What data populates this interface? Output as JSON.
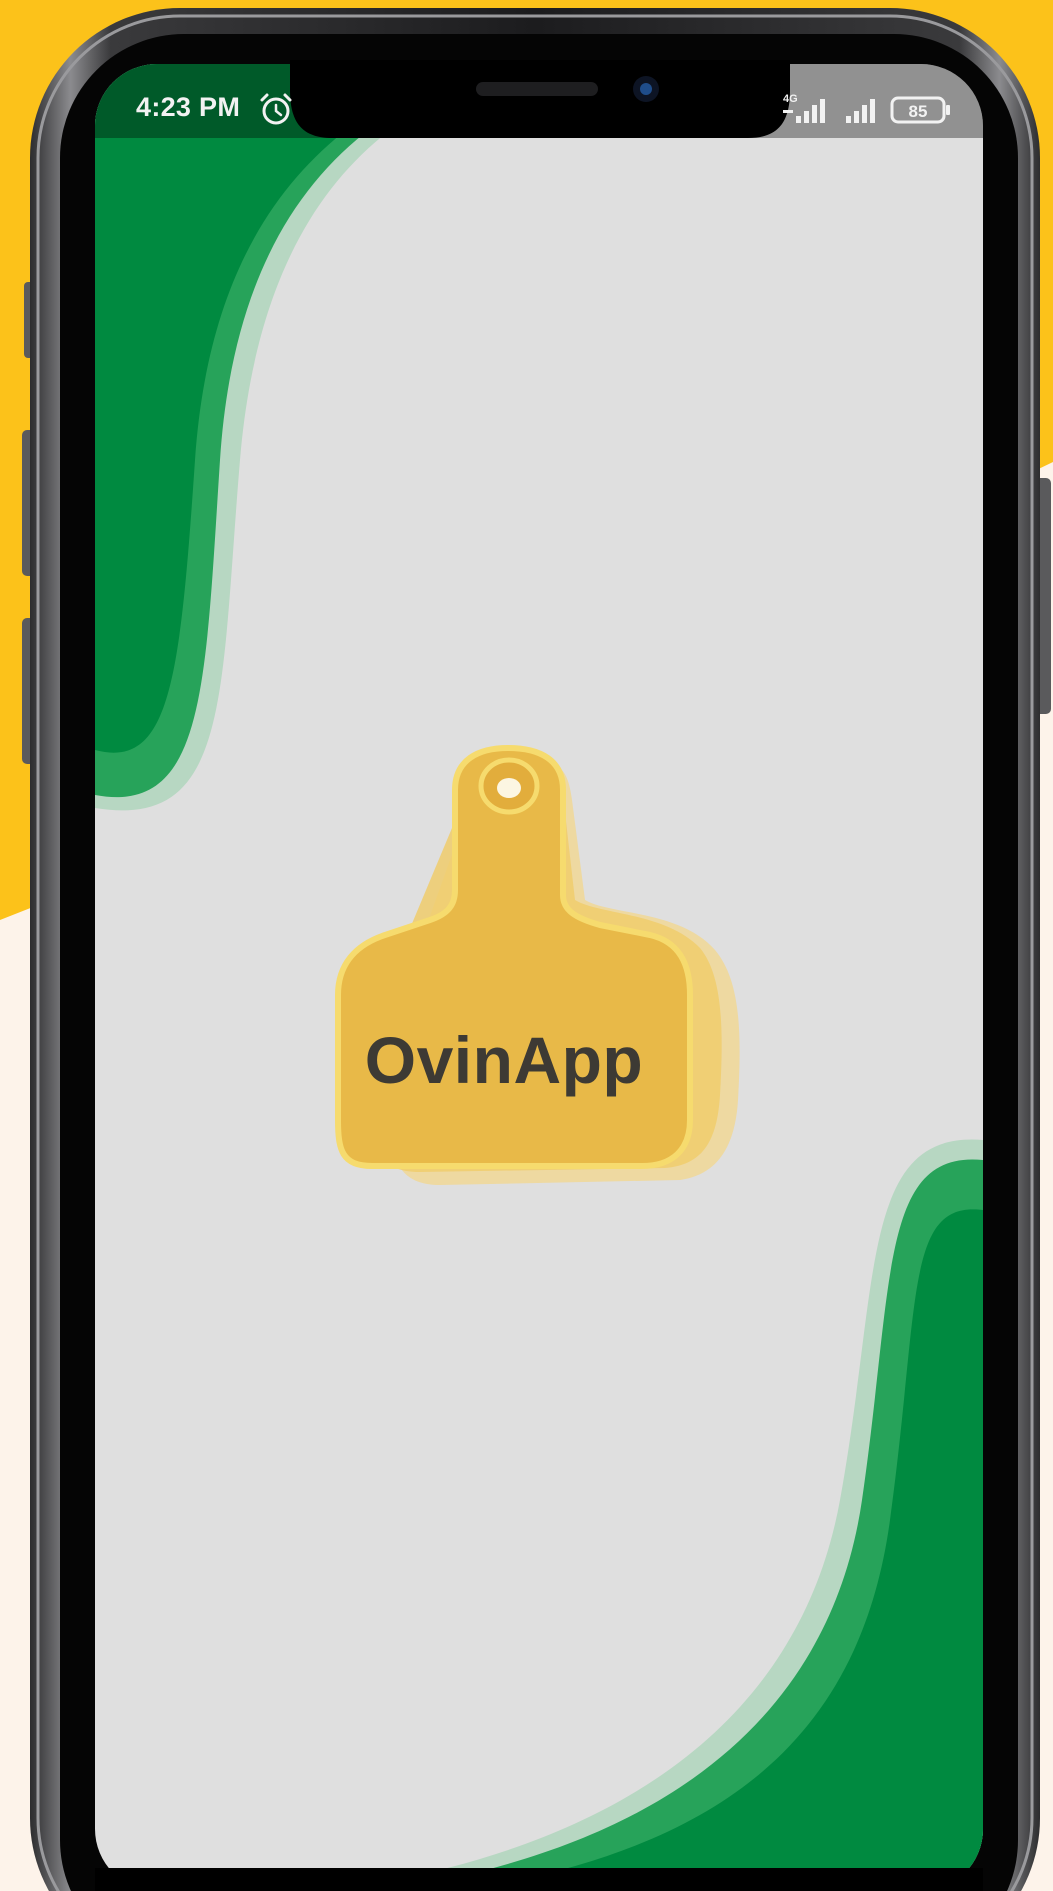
{
  "status_bar": {
    "time": "4:23 PM",
    "icons": [
      "alarm-icon",
      "network-4g-icon",
      "signal-icon",
      "signal-icon",
      "battery-icon"
    ],
    "battery_level": "85",
    "network_type": "4G"
  },
  "splash": {
    "app_name": "OvinApp",
    "logo_icon": "ear-tag-icon"
  },
  "colors": {
    "backdrop_yellow": "#fcc21a",
    "backdrop_cream": "#fdf3ea",
    "screen_background": "#dfdfdf",
    "brand_green": "#008a40",
    "wave_green": "#27a35a",
    "wave_edge": "#b7d7c2",
    "tag_yellow": "#e8b948",
    "title_text": "#3d3a34"
  }
}
